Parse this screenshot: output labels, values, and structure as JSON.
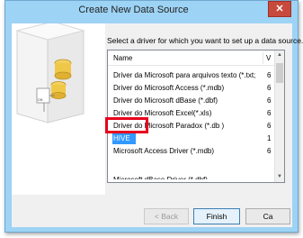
{
  "window": {
    "title": "Create New Data Source",
    "close_glyph": "✕"
  },
  "instruction": "Select a driver for which you want to set up a data source.",
  "list": {
    "columns": {
      "name": "Name",
      "version": "V"
    },
    "rows": [
      {
        "name": "Driver da Microsoft para arquivos texto (*.txt; *.csv)",
        "version": "6"
      },
      {
        "name": "Driver do Microsoft Access (*.mdb)",
        "version": "6"
      },
      {
        "name": "Driver do Microsoft dBase (*.dbf)",
        "version": "6"
      },
      {
        "name": "Driver do Microsoft Excel(*.xls)",
        "version": "6"
      },
      {
        "name": "Driver do Microsoft Paradox (*.db )",
        "version": "6"
      },
      {
        "name": "HIVE",
        "version": "1",
        "selected": true
      },
      {
        "name": "Microsoft Access Driver (*.mdb)",
        "version": "6"
      }
    ],
    "partial_row": "Microsoft dBase Driver (*.dbf)"
  },
  "buttons": {
    "back": "< Back",
    "finish": "Finish",
    "cancel": "Ca"
  },
  "colors": {
    "title_bar": "#9dd3f5",
    "selection": "#3399ff",
    "highlight_box": "#e8001c",
    "close_button": "#c84a3c"
  },
  "icons": {
    "close": "close-icon",
    "illustration": "database-wizard-icon"
  }
}
